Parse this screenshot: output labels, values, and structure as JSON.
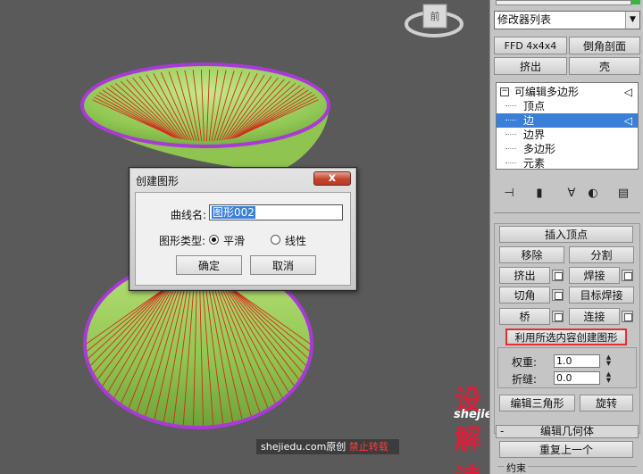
{
  "viewport": {
    "viewcube_label": "前"
  },
  "panel": {
    "modifier_list_label": "修改器列表",
    "buttons": {
      "ffd": "FFD 4x4x4",
      "bevel_profile": "倒角剖面",
      "extrude_top": "挤出",
      "shell": "壳"
    },
    "stack": {
      "root": "可编辑多边形",
      "items": [
        "顶点",
        "边",
        "边界",
        "多边形",
        "元素"
      ],
      "selected_index": 1
    },
    "edit_edges": {
      "insert_vertex": "插入顶点",
      "remove": "移除",
      "split": "分割",
      "extrude": "挤出",
      "weld": "焊接",
      "chamfer": "切角",
      "target_weld": "目标焊接",
      "bridge": "桥",
      "connect": "连接",
      "create_shape": "利用所选内容创建图形",
      "weight_label": "权重:",
      "weight_value": "1.0",
      "crease_label": "折缝:",
      "crease_value": "0.0",
      "edit_tri": "编辑三角形",
      "turn": "旋转"
    },
    "edit_geometry": {
      "collapse_sign": "-",
      "title": "编辑几何体",
      "repeat_last": "重复上一个",
      "constraints": "约束"
    }
  },
  "dialog": {
    "title": "创建图形",
    "close_glyph": "x",
    "curve_name_label": "曲线名:",
    "curve_name_value": "图形002",
    "shape_type_label": "图形类型:",
    "options": [
      "平滑",
      "线性"
    ],
    "selected_option": 0,
    "ok": "确定",
    "cancel": "取消"
  },
  "watermark": {
    "logo_text": "设解读",
    "site": "shejiedu.com",
    "credit_site": "shejiedu.com",
    "credit_original": "原创",
    "credit_warning": "禁止转载"
  },
  "colors": {
    "viewport_bg": "#5a5a5a",
    "mesh_green": "#9ccf5a",
    "mesh_edge_red": "#d42a1a",
    "border_purple": "#a83ad6",
    "selection_blue": "#3a7fd8",
    "create_shape_outline": "#e03030",
    "logo_red": "#d8203a"
  }
}
